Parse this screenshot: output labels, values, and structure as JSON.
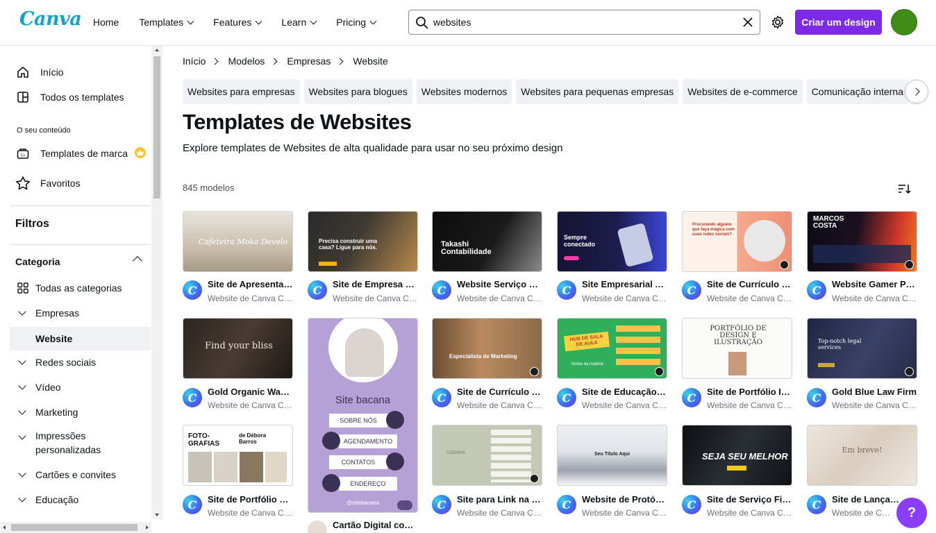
{
  "header": {
    "logo": "Canva",
    "nav": [
      "Home",
      "Templates",
      "Features",
      "Learn",
      "Pricing"
    ],
    "search_value": "websites",
    "cta_label": "Criar um design"
  },
  "sidebar": {
    "home": "Início",
    "all_templates": "Todos os templates",
    "section_label": "O seu conteúdo",
    "brand_templates": "Templates de marca",
    "favorites": "Favoritos",
    "filters_title": "Filtros",
    "category_title": "Categoria",
    "categories": [
      {
        "label": "Todas as categorias"
      },
      {
        "label": "Empresas"
      },
      {
        "label": "Website"
      },
      {
        "label": "Redes sociais"
      },
      {
        "label": "Vídeo"
      },
      {
        "label": "Marketing"
      },
      {
        "label": "Impressões personalizadas"
      },
      {
        "label": "Cartões e convites"
      },
      {
        "label": "Educação"
      }
    ]
  },
  "breadcrumb": [
    "Início",
    "Modelos",
    "Empresas",
    "Website"
  ],
  "chips": [
    "Websites para empresas",
    "Websites para blogues",
    "Websites modernos",
    "Websites para pequenas empresas",
    "Websites de e-commerce",
    "Comunicação interna",
    "C"
  ],
  "title": "Templates de Websites",
  "subtitle": "Explore templates de Websites de alta qualidade para usar no seu próximo design",
  "count": "845 modelos",
  "colors": {
    "accent": "#7d2ae8",
    "help": "#8b3dff",
    "canva_blue": "#13a3c9"
  },
  "cards": [
    {
      "title": "Site de Apresentação",
      "author": "Website de Canva Creative Studio",
      "thumb": [
        "Cafeteira Moka Develo"
      ]
    },
    {
      "title": "Site de Empresa Construção",
      "author": "Website de Canva Creative Studio",
      "thumb": [
        "Precisa construir uma casa? Ligue para nós."
      ]
    },
    {
      "title": "Website Serviço de Contabilidade",
      "author": "Website de Canva Creative Studio",
      "thumb": [
        "Takashi Contabilidade"
      ]
    },
    {
      "title": "Site Empresarial App",
      "author": "Website de Canva Creative Studio",
      "thumb": [
        "Sempre conectado"
      ]
    },
    {
      "title": "Site de Currículo Social Media",
      "author": "Website de Canva Creative Studio",
      "thumb": [
        "Procurando alguém que faça mágica com suas redes sociais?"
      ]
    },
    {
      "title": "Website Gamer Pessoal",
      "author": "Website de Canva Creative Studio",
      "thumb": [
        "MARCOS COSTA"
      ]
    },
    {
      "title": "Gold Organic Warm Spa",
      "author": "Website de Canva Creative Studio",
      "thumb": [
        "Find your bliss"
      ]
    },
    {
      "title": "Cartão Digital com Links",
      "author": "Website de Canva Creative Studio",
      "thumb": [
        "Site bacana",
        "SOBRE NÓS",
        "AGENDAMENTO",
        "CONTATOS",
        "ENDEREÇO",
        "@sitebacana"
      ]
    },
    {
      "title": "Site de Currículo Marketing",
      "author": "Website de Canva Creative Studio",
      "thumb": [
        "Especialista de Marketing"
      ]
    },
    {
      "title": "Site de Educação Sala de Aula",
      "author": "Website de Canva Creative Studio",
      "thumb": [
        "HUB DE SALA DE AULA",
        "Nome da matéria"
      ]
    },
    {
      "title": "Site de Portfólio Ilustração",
      "author": "Website de Canva Creative Studio",
      "thumb": [
        "PORTFÓLIO DE DESIGN E ILUSTRAÇÃO"
      ]
    },
    {
      "title": "Gold Blue Law Firm",
      "author": "Website de Canva Creative Studio",
      "thumb": [
        "Top-notch legal services"
      ]
    },
    {
      "title": "Site de Portfólio Fotografia",
      "author": "Website de Canva Creative Studio",
      "thumb": [
        "FOTO-GRAFIAS",
        "de Débora Barros"
      ]
    },
    {
      "title": "Site para Link na Bio",
      "author": "Website de Canva Creative Studio",
      "thumb": [
        "COZINHA"
      ]
    },
    {
      "title": "Website de Protótipo",
      "author": "Website de Canva Creative Studio",
      "thumb": [
        "Seu Título Aqui"
      ]
    },
    {
      "title": "Site de Serviço Fitness",
      "author": "Website de Canva Creative Studio",
      "thumb": [
        "SEJA SEU MELHOR"
      ]
    },
    {
      "title": "Site de Lançamento",
      "author": "Website de Canva Creative Studio",
      "thumb": [
        "Em breve!"
      ]
    }
  ],
  "help_label": "?"
}
